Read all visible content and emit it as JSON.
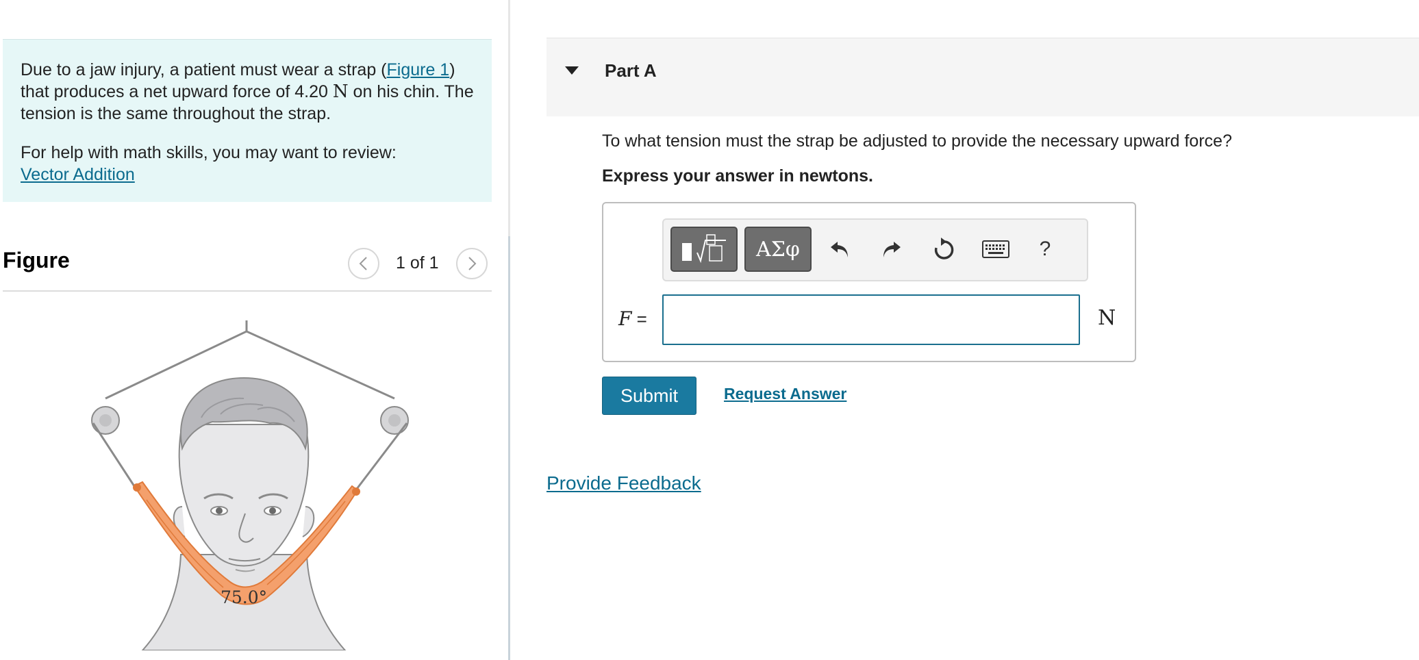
{
  "problem": {
    "text_before_link": "Due to a jaw injury, a patient must wear a strap (",
    "figure_link": "Figure 1",
    "text_after_link": ") that produces a net upward force of 4.20 ",
    "force_unit": "N",
    "text_end": " on his chin. The tension is the same throughout the strap.",
    "help_text": "For help with math skills, you may want to review:",
    "help_link": "Vector Addition"
  },
  "figure": {
    "title": "Figure",
    "page_indicator": "1 of 1",
    "angle_label": "75.0°",
    "prev_icon": "chevron-left-icon",
    "next_icon": "chevron-right-icon",
    "strap_color": "#f4a06c"
  },
  "part": {
    "title": "Part A",
    "toggle_icon": "caret-down-icon",
    "question": "To what tension must the strap be adjusted to provide the necessary upward force?",
    "instruction": "Express your answer in newtons."
  },
  "toolbar": {
    "templates_icon": "templates-icon",
    "greek_label": "ΑΣφ",
    "undo_icon": "undo-icon",
    "redo_icon": "redo-icon",
    "reset_icon": "reset-icon",
    "keyboard_icon": "keyboard-icon",
    "help_label": "?"
  },
  "answer": {
    "variable": "F",
    "equals": "=",
    "value": "",
    "unit": "N"
  },
  "actions": {
    "submit_label": "Submit",
    "request_answer_label": "Request Answer",
    "feedback_label": "Provide Feedback"
  },
  "colors": {
    "accent": "#1a7aa0",
    "link": "#0b6b8e",
    "problem_bg": "#e6f7f7"
  }
}
